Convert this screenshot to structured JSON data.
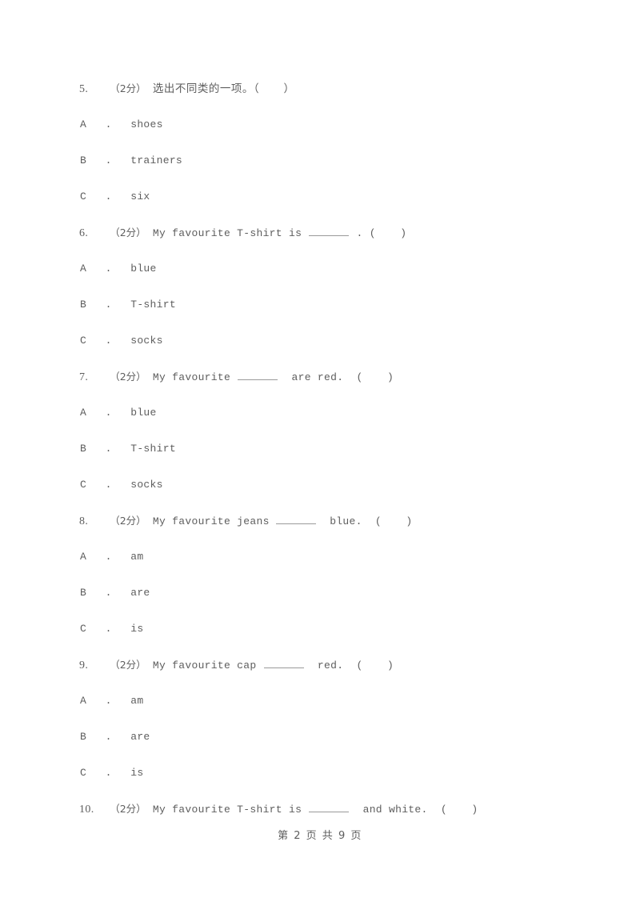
{
  "document": {
    "type": "exam-paper",
    "text_color": "#5e5e5e",
    "background_color": "#ffffff"
  },
  "footer": {
    "page_indicator": "第 2 页 共 9 页"
  },
  "questions": [
    {
      "number": "5.",
      "score": "（2分）",
      "stem_cjk": "选出不同类的一项。（",
      "stem_cjk_close": "）",
      "has_blank": false,
      "options": [
        {
          "letter": "A",
          "dot": ".",
          "text": "shoes"
        },
        {
          "letter": "B",
          "dot": ".",
          "text": "trainers"
        },
        {
          "letter": "C",
          "dot": ".",
          "text": "six"
        }
      ]
    },
    {
      "number": "6.",
      "score": "（2分）",
      "stem_before": "My favourite T-shirt is ",
      "stem_after": ". (",
      "stem_close": ")",
      "has_blank": true,
      "options": [
        {
          "letter": "A",
          "dot": ".",
          "text": "blue"
        },
        {
          "letter": "B",
          "dot": ".",
          "text": "T-shirt"
        },
        {
          "letter": "C",
          "dot": ".",
          "text": "socks"
        }
      ]
    },
    {
      "number": "7.",
      "score": "（2分）",
      "stem_before": "My favourite ",
      "stem_after": " are red.  (",
      "stem_close": ")",
      "has_blank": true,
      "options": [
        {
          "letter": "A",
          "dot": ".",
          "text": "blue"
        },
        {
          "letter": "B",
          "dot": ".",
          "text": "T-shirt"
        },
        {
          "letter": "C",
          "dot": ".",
          "text": "socks"
        }
      ]
    },
    {
      "number": "8.",
      "score": "（2分）",
      "stem_before": "My favourite jeans",
      "stem_after": " blue.  (",
      "stem_close": ")",
      "has_blank": true,
      "blank_tight": true,
      "options": [
        {
          "letter": "A",
          "dot": ".",
          "text": "am"
        },
        {
          "letter": "B",
          "dot": ".",
          "text": "are"
        },
        {
          "letter": "C",
          "dot": ".",
          "text": "is"
        }
      ]
    },
    {
      "number": "9.",
      "score": "（2分）",
      "stem_before": "My favourite cap ",
      "stem_after": " red.  (",
      "stem_close": ")",
      "has_blank": true,
      "options": [
        {
          "letter": "A",
          "dot": ".",
          "text": "am"
        },
        {
          "letter": "B",
          "dot": ".",
          "text": "are"
        },
        {
          "letter": "C",
          "dot": ".",
          "text": "is"
        }
      ]
    },
    {
      "number": "10.",
      "score": "（2分）",
      "stem_before": "My favourite T-shirt is ",
      "stem_after": " and white.  (",
      "stem_close": ")",
      "has_blank": true,
      "options": []
    }
  ]
}
